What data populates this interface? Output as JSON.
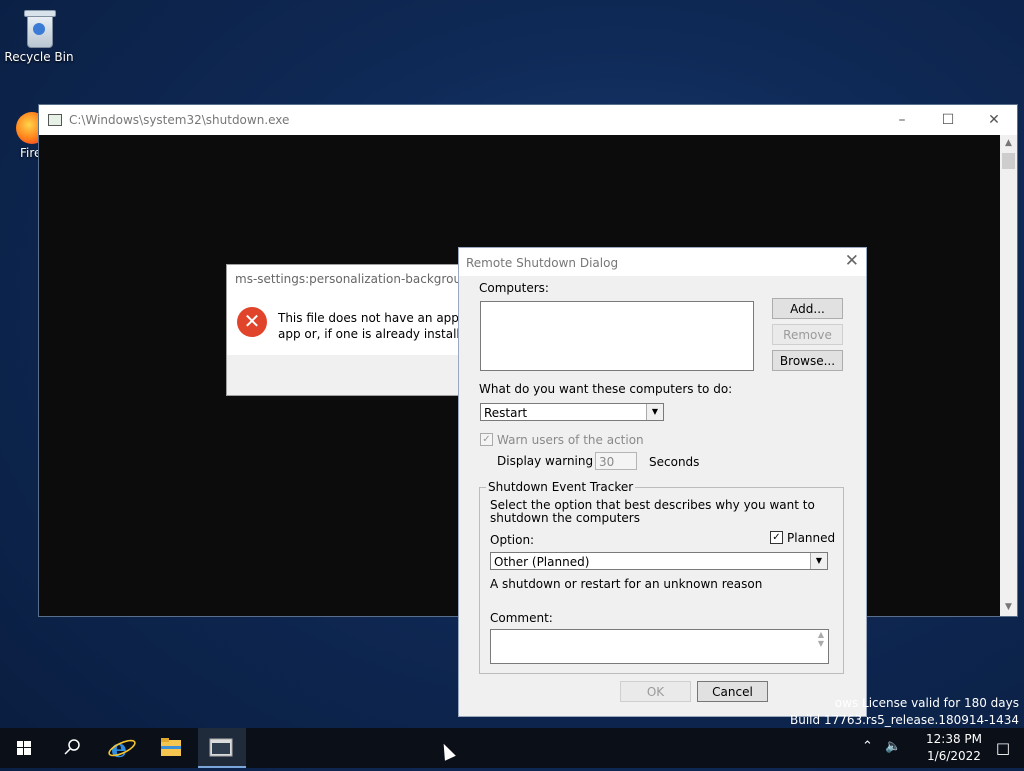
{
  "desktop": {
    "icons": [
      {
        "label": "Recycle Bin"
      },
      {
        "label": "Fire"
      }
    ]
  },
  "console": {
    "title": "C:\\Windows\\system32\\shutdown.exe"
  },
  "error_box": {
    "title": "ms-settings:personalization-background",
    "message_line1": "This file does not have an app asso",
    "message_line2": "app or, if one is already installed, c"
  },
  "dialog": {
    "title": "Remote Shutdown Dialog",
    "computers_label": "Computers:",
    "add_label": "Add...",
    "remove_label": "Remove",
    "browse_label": "Browse...",
    "action_question": "What do you want these computers to do:",
    "action_value": "Restart",
    "warn_label": "Warn users of the action",
    "warn_checked": true,
    "display_warning_label": "Display warning for",
    "warning_seconds": "30",
    "seconds_label": "Seconds",
    "tracker_label": "Shutdown Event Tracker",
    "tracker_description": "Select the option that best describes why you want to shutdown the computers",
    "option_label": "Option:",
    "planned_label": "Planned",
    "planned_checked": true,
    "option_value": "Other (Planned)",
    "option_description": "A shutdown or restart for an unknown reason",
    "comment_label": "Comment:",
    "comment_value": "",
    "ok_label": "OK",
    "cancel_label": "Cancel"
  },
  "watermark": {
    "line1": "ows License valid for 180 days",
    "line2": "Build 17763.rs5_release.180914-1434"
  },
  "taskbar": {
    "time": "12:38 PM",
    "date": "1/6/2022"
  },
  "colors": {
    "error_red": "#e0442b",
    "taskbar": "#0b0f18",
    "accent_blue": "#7aa6da"
  }
}
